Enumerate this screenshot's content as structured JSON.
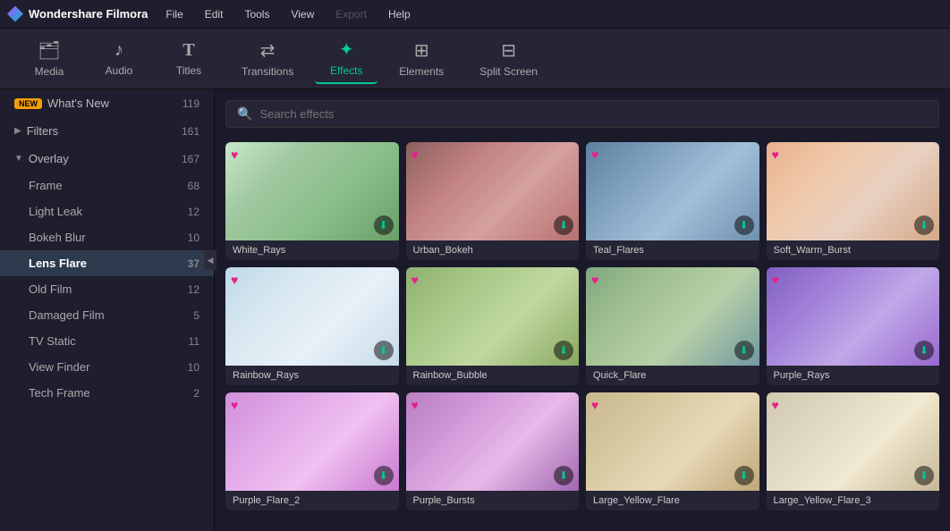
{
  "app": {
    "name": "Wondershare Filmora"
  },
  "menu": {
    "items": [
      "File",
      "Edit",
      "Tools",
      "View",
      "Export",
      "Help"
    ],
    "disabled": [
      "Export"
    ]
  },
  "toolbar": {
    "items": [
      {
        "id": "media",
        "label": "Media",
        "icon": "🗂"
      },
      {
        "id": "audio",
        "label": "Audio",
        "icon": "♪"
      },
      {
        "id": "titles",
        "label": "Titles",
        "icon": "T"
      },
      {
        "id": "transitions",
        "label": "Transitions",
        "icon": "⇄"
      },
      {
        "id": "effects",
        "label": "Effects",
        "icon": "✦"
      },
      {
        "id": "elements",
        "label": "Elements",
        "icon": "⊞"
      },
      {
        "id": "split-screen",
        "label": "Split Screen",
        "icon": "⊟"
      }
    ],
    "active": "effects"
  },
  "sidebar": {
    "items": [
      {
        "id": "whats-new",
        "label": "What's New",
        "count": 119,
        "badge": "NEW",
        "type": "root",
        "expanded": false
      },
      {
        "id": "filters",
        "label": "Filters",
        "count": 161,
        "type": "root",
        "expanded": false
      },
      {
        "id": "overlay",
        "label": "Overlay",
        "count": 167,
        "type": "root",
        "expanded": true,
        "children": [
          {
            "id": "frame",
            "label": "Frame",
            "count": 68
          },
          {
            "id": "light-leak",
            "label": "Light Leak",
            "count": 12
          },
          {
            "id": "bokeh-blur",
            "label": "Bokeh Blur",
            "count": 10
          },
          {
            "id": "lens-flare",
            "label": "Lens Flare",
            "count": 37,
            "active": true
          },
          {
            "id": "old-film",
            "label": "Old Film",
            "count": 12
          },
          {
            "id": "damaged-film",
            "label": "Damaged Film",
            "count": 5
          },
          {
            "id": "tv-static",
            "label": "TV Static",
            "count": 11
          },
          {
            "id": "view-finder",
            "label": "View Finder",
            "count": 10
          },
          {
            "id": "tech-frame",
            "label": "Tech Frame",
            "count": 2
          }
        ]
      }
    ]
  },
  "search": {
    "placeholder": "Search effects"
  },
  "effects": {
    "items": [
      {
        "id": "white-rays",
        "name": "White_Rays",
        "thumb": "white-rays"
      },
      {
        "id": "urban-bokeh",
        "name": "Urban_Bokeh",
        "thumb": "urban-bokeh"
      },
      {
        "id": "teal-flares",
        "name": "Teal_Flares",
        "thumb": "teal-flares"
      },
      {
        "id": "soft-warm-burst",
        "name": "Soft_Warm_Burst",
        "thumb": "soft-warm"
      },
      {
        "id": "rainbow-rays",
        "name": "Rainbow_Rays",
        "thumb": "rainbow-rays"
      },
      {
        "id": "rainbow-bubble",
        "name": "Rainbow_Bubble",
        "thumb": "rainbow-bubble"
      },
      {
        "id": "quick-flare",
        "name": "Quick_Flare",
        "thumb": "quick-flare"
      },
      {
        "id": "purple-rays",
        "name": "Purple_Rays",
        "thumb": "purple-rays"
      },
      {
        "id": "purple-flare-2",
        "name": "Purple_Flare_2",
        "thumb": "purple-flare2"
      },
      {
        "id": "purple-bursts",
        "name": "Purple_Bursts",
        "thumb": "purple-bursts"
      },
      {
        "id": "large-yellow-flare",
        "name": "Large_Yellow_Flare",
        "thumb": "large-yellow"
      },
      {
        "id": "large-yellow-flare-3",
        "name": "Large_Yellow_Flare_3",
        "thumb": "large-yellow3"
      }
    ]
  }
}
